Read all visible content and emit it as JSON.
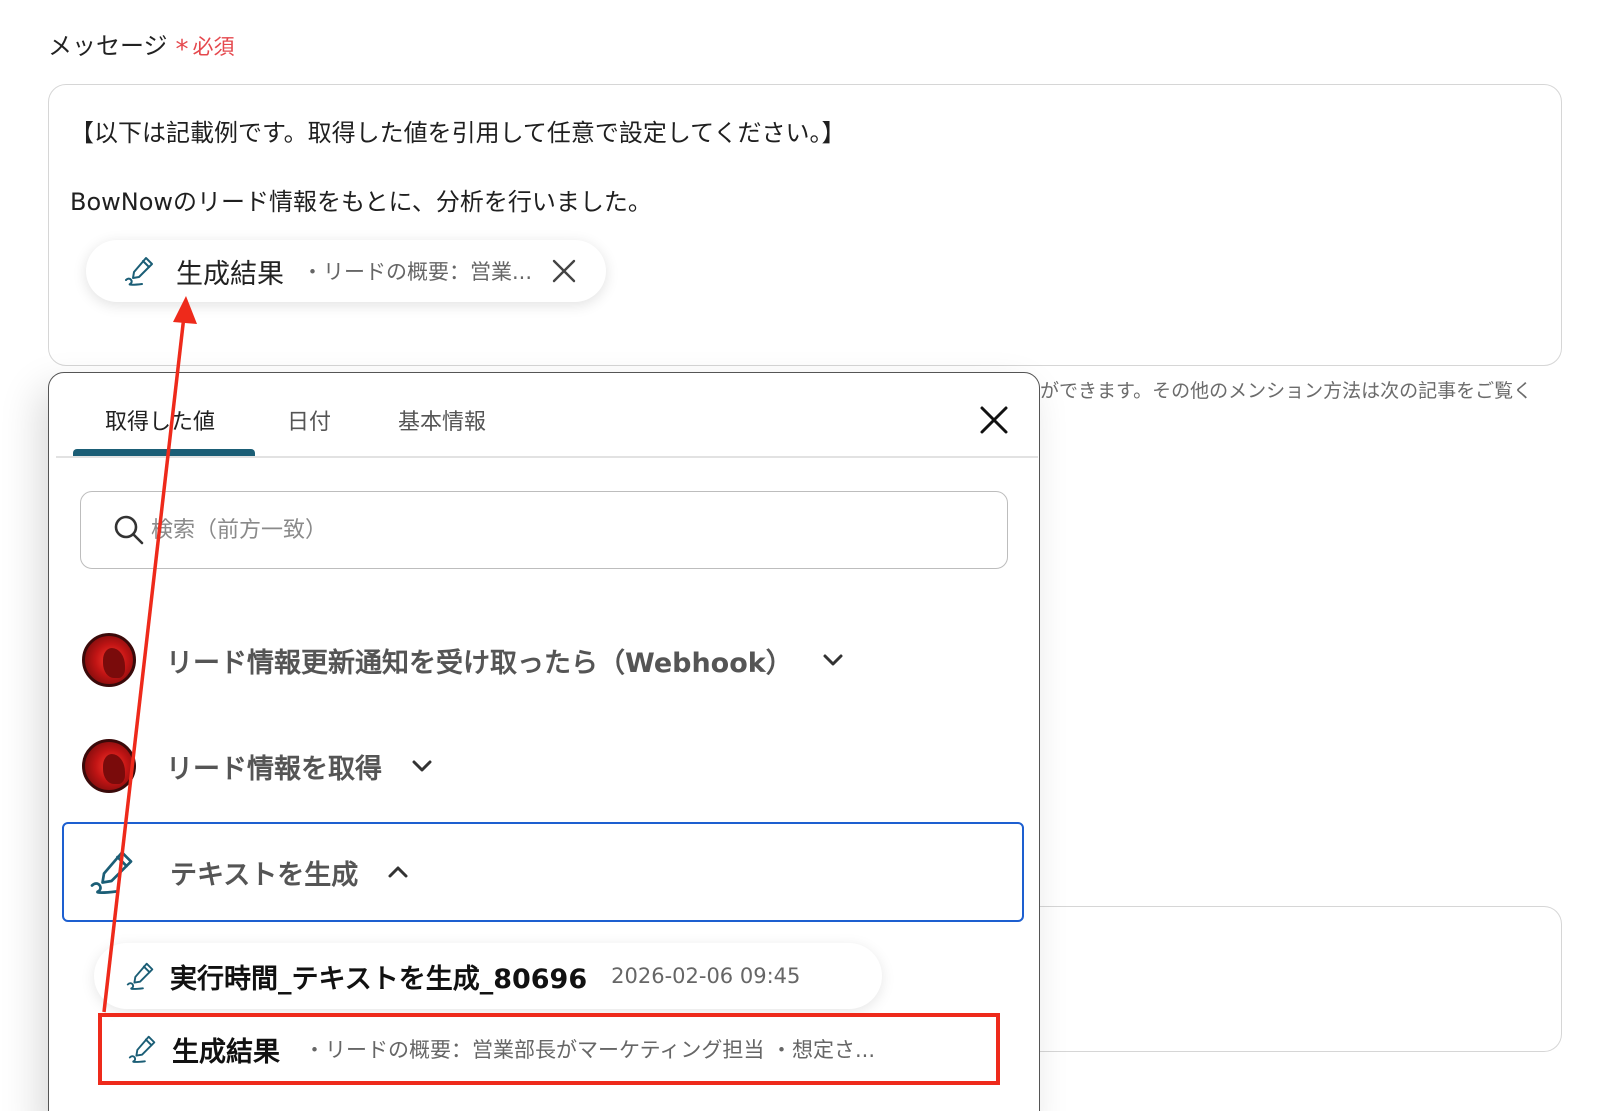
{
  "field": {
    "label": "メッセージ",
    "required_star": "*",
    "required_text": "必須"
  },
  "message": {
    "line1": "【以下は記載例です。取得した値を引用して任意で設定してください。】",
    "line2": "BowNowのリード情報をもとに、分析を行いました。",
    "chip": {
      "title": "生成結果",
      "preview": "・リードの概要：営業..."
    }
  },
  "helper_text": "ができます。その他のメンション方法は次の記事をご覧く",
  "popover": {
    "tabs": [
      {
        "label": "取得した値"
      },
      {
        "label": "日付"
      },
      {
        "label": "基本情報"
      }
    ],
    "active_tab": "取得した値",
    "search": {
      "placeholder": "検索（前方一致）",
      "value": ""
    },
    "steps": [
      {
        "label": "リード情報更新通知を受け取ったら（Webhook）",
        "expanded": false,
        "icon": "bownow-avatar"
      },
      {
        "label": "リード情報を取得",
        "expanded": false,
        "icon": "bownow-avatar"
      },
      {
        "label": "テキストを生成",
        "expanded": true,
        "icon": "ai-pen-icon"
      }
    ],
    "sub_items": [
      {
        "title": "実行時間_テキストを生成_80696",
        "meta": "2026-02-06 09:45"
      },
      {
        "title": "生成結果",
        "meta": "・リードの概要：営業部長がマーケティング担当 ・想定さ..."
      }
    ]
  },
  "colors": {
    "accent_tab": "#1b5e76",
    "selected_border": "#1d5fd0",
    "annotation_red": "#ee2a1b",
    "required_red": "#e5484d"
  }
}
